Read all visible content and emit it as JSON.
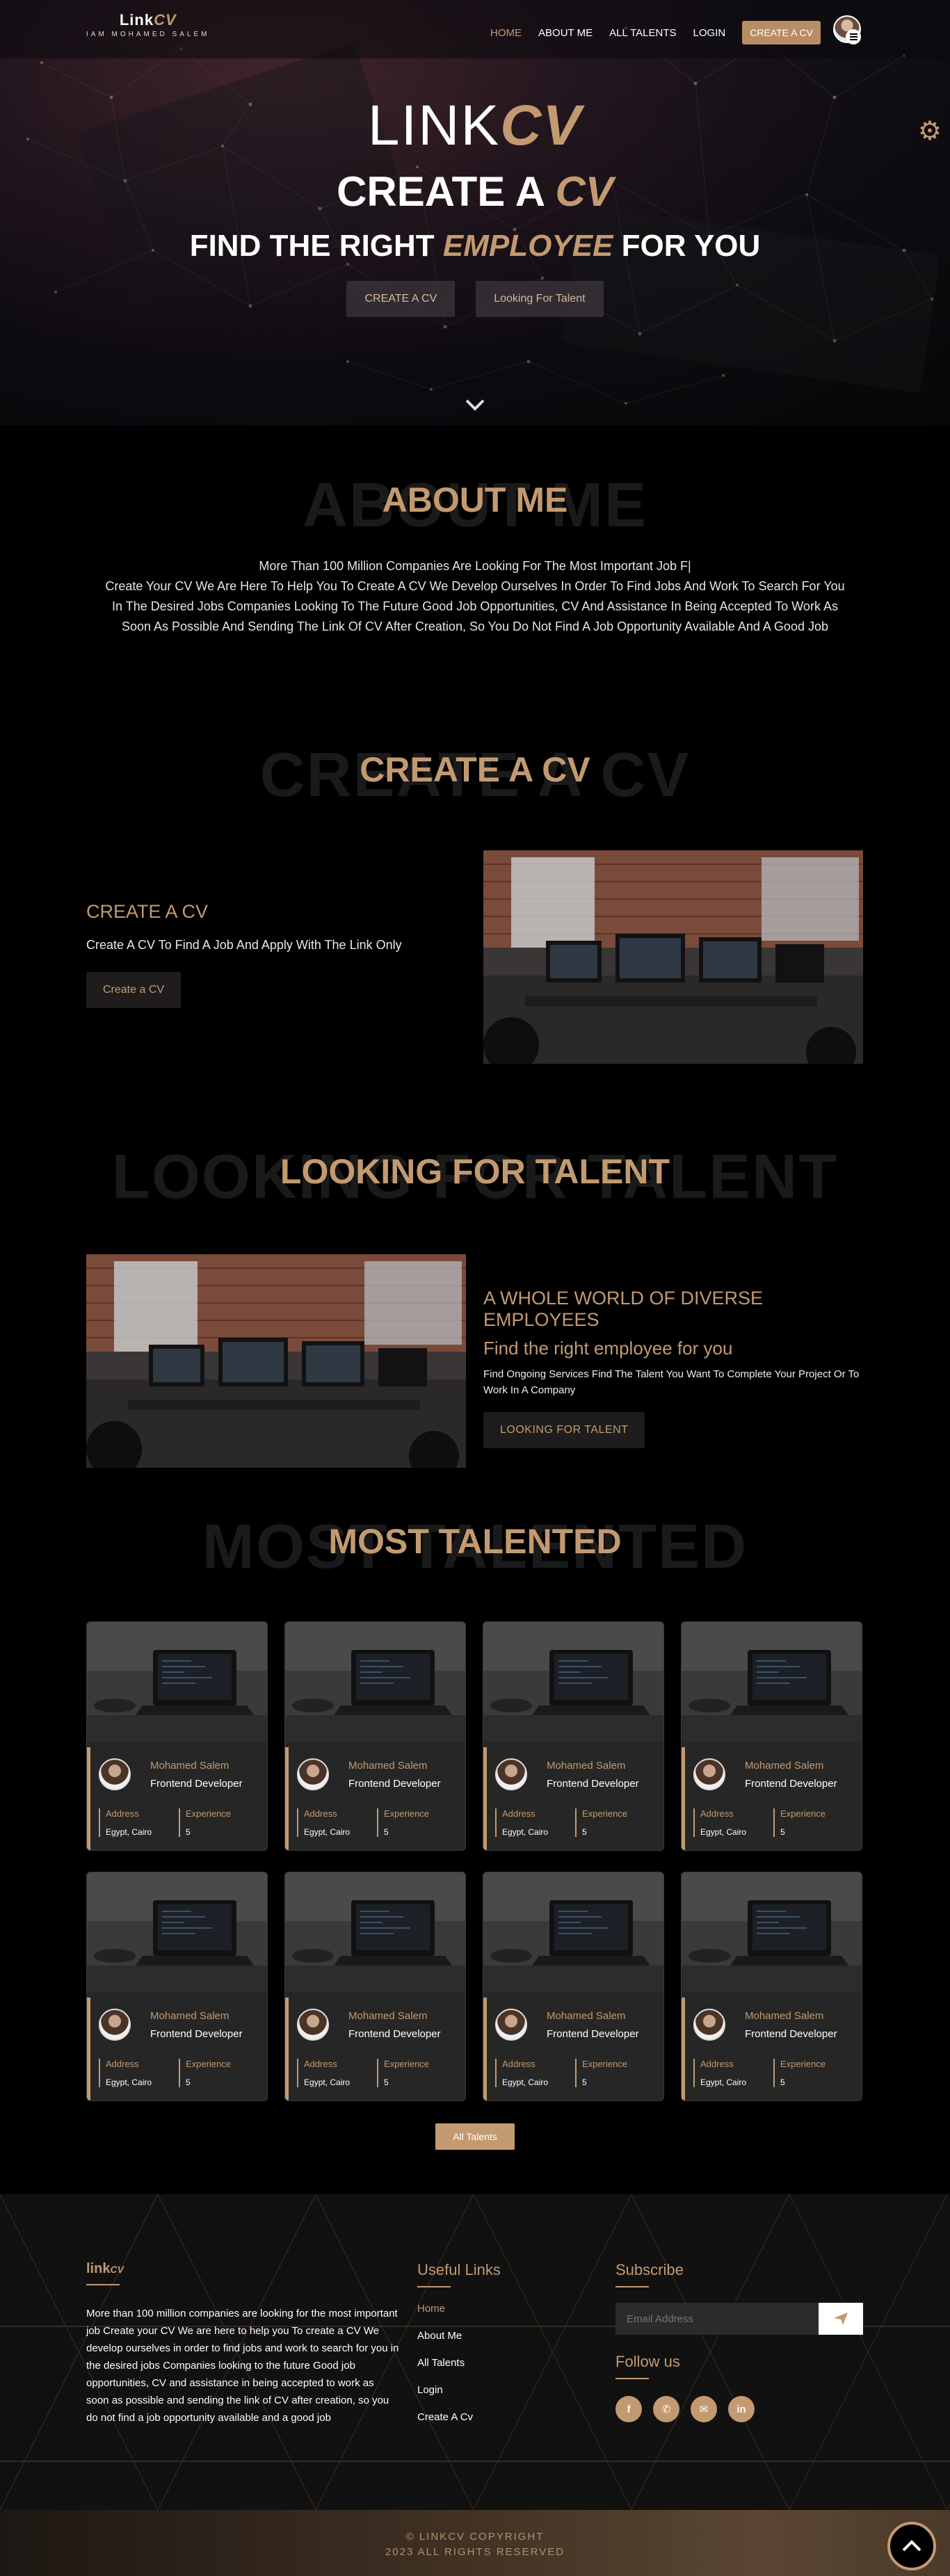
{
  "nav": {
    "brand": "Link",
    "brand_accent": "CV",
    "tagline": "IAM MOHAMED SALEM",
    "items": [
      {
        "label": "HOME",
        "active": true
      },
      {
        "label": "ABOUT ME",
        "active": false
      },
      {
        "label": "ALL TALENTS",
        "active": false
      },
      {
        "label": "LOGIN",
        "active": false
      }
    ],
    "cta": "CREATE A CV"
  },
  "hero": {
    "title": "LINK",
    "title_accent": "CV",
    "line1": "CREATE A",
    "line1_accent": "CV",
    "line2_pre": "FIND THE RIGHT",
    "line2_accent": "EMPLOYEE",
    "line2_post": "FOR YOU",
    "btn_create": "CREATE A CV",
    "btn_talent": "Looking For Talent"
  },
  "about": {
    "ghost": "ABOUT ME",
    "title": "ABOUT ME",
    "line1": "More Than 100 Million Companies Are Looking For The Most Important Job F|",
    "body": "Create Your CV We Are Here To Help You To Create A CV We Develop Ourselves In Order To Find Jobs And Work To Search For You In The Desired Jobs Companies Looking To The Future Good Job Opportunities, CV And Assistance In Being Accepted To Work As Soon As Possible And Sending The Link Of CV After Creation, So You Do Not Find A Job Opportunity Available And A Good Job"
  },
  "create": {
    "ghost": "CREATE A CV",
    "title": "CREATE A CV",
    "heading": "CREATE A CV",
    "text": "Create A CV To Find A Job And Apply With The Link Only",
    "button": "Create a CV"
  },
  "talent": {
    "ghost": "LOOKING FOR TALENT",
    "title": "LOOKING FOR TALENT",
    "heading": "A WHOLE WORLD OF DIVERSE EMPLOYEES",
    "sub": "Find the right employee for you",
    "text": "Find Ongoing Services Find The Talent You Want To Complete Your Project Or To Work In A Company",
    "button": "LOOKING FOR TALENT"
  },
  "most": {
    "ghost": "MOST TALENTED",
    "title": "MOST TALENTED",
    "address_label": "Address",
    "experience_label": "Experience",
    "cards": [
      {
        "name": "Mohamed Salem",
        "role": "Frontend Developer",
        "address": "Egypt, Cairo",
        "experience": "5"
      },
      {
        "name": "Mohamed Salem",
        "role": "Frontend Developer",
        "address": "Egypt, Cairo",
        "experience": "5"
      },
      {
        "name": "Mohamed Salem",
        "role": "Frontend Developer",
        "address": "Egypt, Cairo",
        "experience": "5"
      },
      {
        "name": "Mohamed Salem",
        "role": "Frontend Developer",
        "address": "Egypt, Cairo",
        "experience": "5"
      },
      {
        "name": "Mohamed Salem",
        "role": "Frontend Developer",
        "address": "Egypt, Cairo",
        "experience": "5"
      },
      {
        "name": "Mohamed Salem",
        "role": "Frontend Developer",
        "address": "Egypt, Cairo",
        "experience": "5"
      },
      {
        "name": "Mohamed Salem",
        "role": "Frontend Developer",
        "address": "Egypt, Cairo",
        "experience": "5"
      },
      {
        "name": "Mohamed Salem",
        "role": "Frontend Developer",
        "address": "Egypt, Cairo",
        "experience": "5"
      }
    ],
    "all_button": "All Talents"
  },
  "footer": {
    "brand": "link",
    "brand_accent": "CV",
    "about": "More than 100 million companies are looking for the most important job Create your CV We are here to help you To create a CV We develop ourselves in order to find jobs and work to search for you in the desired jobs Companies looking to the future Good job opportunities, CV and assistance in being accepted to work as soon as possible and sending the link of CV after creation, so you do not find a job opportunity available and a good job",
    "links_title": "Useful Links",
    "links": [
      {
        "label": "Home",
        "active": true
      },
      {
        "label": "About Me",
        "active": false
      },
      {
        "label": "All Talents",
        "active": false
      },
      {
        "label": "Login",
        "active": false
      },
      {
        "label": "Create A Cv",
        "active": false
      }
    ],
    "subscribe_title": "Subscribe",
    "email_placeholder": "Email Address",
    "follow_title": "Follow us",
    "socials": [
      "facebook-icon",
      "whatsapp-icon",
      "mail-icon",
      "linkedin-icon"
    ],
    "copyright1": "© LINKCV COPYRIGHT",
    "copyright2": "2023 ALL RIGHTS RESERVED"
  },
  "colors": {
    "accent": "#c39a70",
    "background": "#000000",
    "card": "#262626"
  }
}
